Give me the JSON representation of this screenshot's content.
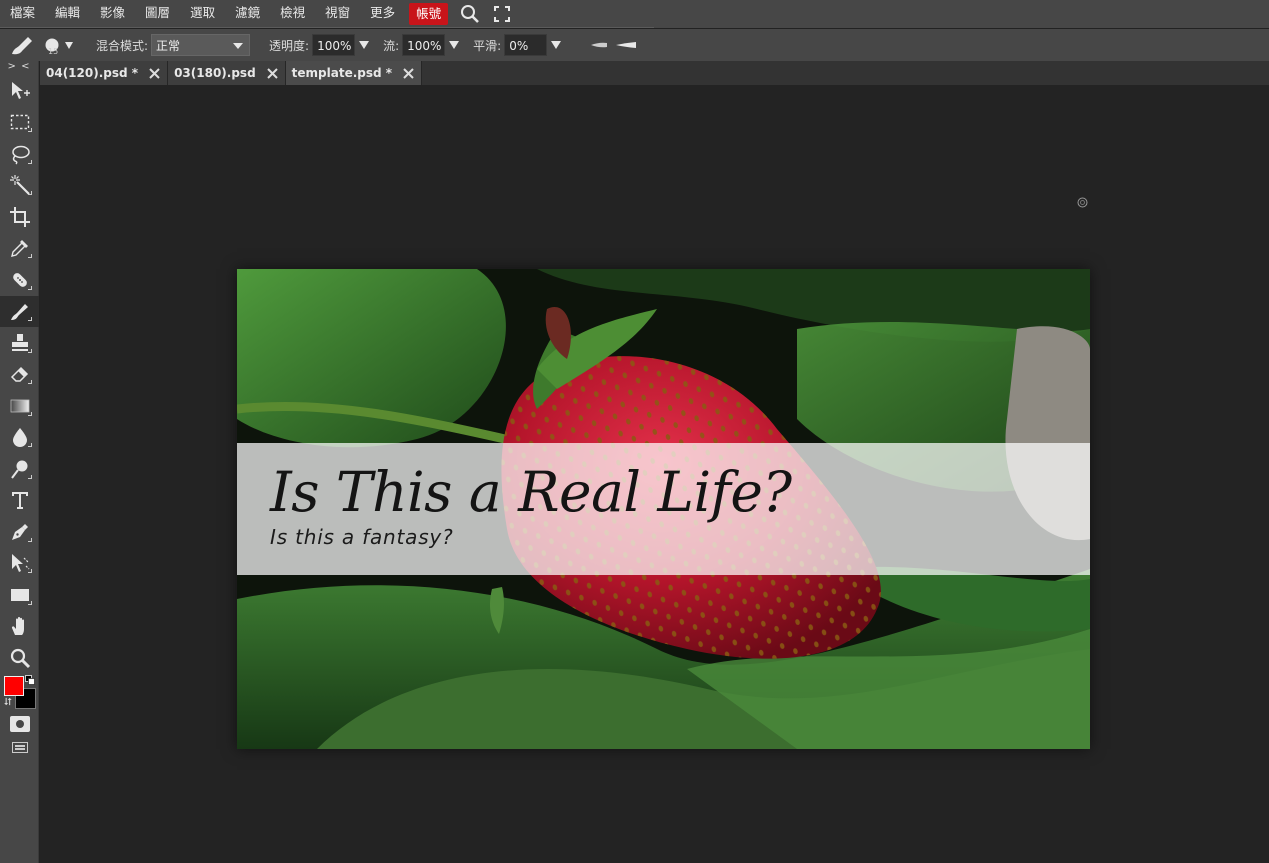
{
  "menu": {
    "items": [
      "檔案",
      "編輯",
      "影像",
      "圖層",
      "選取",
      "濾鏡",
      "檢視",
      "視窗",
      "更多"
    ],
    "account": "帳號",
    "icons": [
      "search-icon",
      "fullscreen-icon"
    ]
  },
  "options": {
    "brush_size": "15",
    "blend_label": "混合模式:",
    "blend_value": "正常",
    "opacity_label": "透明度:",
    "opacity_value": "100%",
    "flow_label": "流:",
    "flow_value": "100%",
    "smooth_label": "平滑:",
    "smooth_value": "0%"
  },
  "toolbar": {
    "collapse_label": "> <",
    "tools": [
      "move-tool-icon",
      "marquee-tool-icon",
      "lasso-tool-icon",
      "magic-wand-tool-icon",
      "crop-tool-icon",
      "eyedropper-tool-icon",
      "healing-tool-icon",
      "brush-tool-icon",
      "stamp-tool-icon",
      "eraser-tool-icon",
      "gradient-tool-icon",
      "blur-tool-icon",
      "dodge-tool-icon",
      "type-tool-icon",
      "pen-tool-icon",
      "path-select-tool-icon",
      "shape-tool-icon",
      "hand-tool-icon",
      "zoom-tool-icon"
    ],
    "active_tool": "brush-tool-icon",
    "foreground_color": "#ff0000",
    "background_color": "#000000"
  },
  "tabs": [
    {
      "label": "04(120).psd *",
      "active": false
    },
    {
      "label": "03(180).psd",
      "active": false
    },
    {
      "label": "template.psd *",
      "active": true
    }
  ],
  "document": {
    "headline": "Is This a Real Life?",
    "subline": "Is this a fantasy?"
  },
  "colors": {
    "accent": "#c8141a",
    "panel": "#474747",
    "workspace": "#232323"
  }
}
